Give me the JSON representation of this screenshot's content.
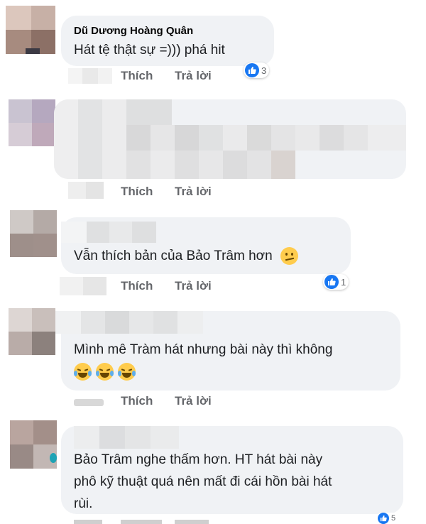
{
  "comments": [
    {
      "author": "Dũ Dương Hoàng Quân",
      "text": "Hát tệ thật sự =))) phá hit",
      "actions": {
        "like": "Thích",
        "reply": "Trả lời"
      },
      "reaction": {
        "icon": "like-icon",
        "count": "3"
      }
    },
    {
      "actions": {
        "like": "Thích",
        "reply": "Trả lời"
      }
    },
    {
      "text": "Vẫn thích bản của Bảo Trâm hơn",
      "emoji": "confused-face-emoji",
      "actions": {
        "like": "Thích",
        "reply": "Trả lời"
      },
      "reaction": {
        "icon": "like-icon",
        "count": "1"
      }
    },
    {
      "text": "Mình mê Tràm hát nhưng bài này thì không",
      "emoji": "tears-of-joy-emoji",
      "actions": {
        "like": "Thích",
        "reply": "Trả lời"
      }
    },
    {
      "text_lines": [
        "Bảo Trâm nghe thấm hơn. HT hát bài này",
        "phô kỹ thuật quá nên mất đi cái hồn bài hát",
        "rùi."
      ],
      "reaction": {
        "icon": "like-icon",
        "count": "5"
      }
    }
  ],
  "colors": {
    "bubble": "#f0f2f5",
    "action": "#65676b",
    "like": "#1877f2"
  }
}
